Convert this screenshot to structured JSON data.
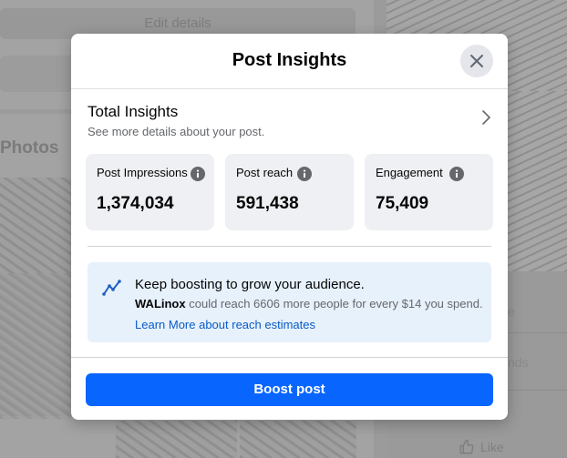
{
  "background": {
    "edit_details": "Edit details",
    "photos_title": "Photos",
    "like_label": "Like",
    "faded_right_1": "e",
    "faded_right_2": "nds"
  },
  "modal": {
    "title": "Post Insights",
    "total_insights": {
      "title": "Total Insights",
      "subtitle": "See more details about your post."
    },
    "stats": [
      {
        "label": "Post Impressions",
        "value": "1,374,034"
      },
      {
        "label": "Post reach",
        "value": "591,438"
      },
      {
        "label": "Engagement",
        "value": "75,409"
      }
    ],
    "boost_promo": {
      "title": "Keep boosting to grow your audience.",
      "page_name": "WALinox",
      "description_rest": "could reach 6606 more people for every $14 you spend.",
      "link": "Learn More about reach estimates"
    },
    "boost_button": "Boost post"
  },
  "colors": {
    "primary_button": "#0866ff",
    "link": "#0a5bc4",
    "promo_background": "#e7f1fc",
    "stat_card_background": "#eef0f3"
  },
  "icons": {
    "close": "close-icon",
    "chevron": "chevron-right-icon",
    "info": "info-icon",
    "trend": "trend-up-icon",
    "like": "thumbs-up-icon"
  }
}
